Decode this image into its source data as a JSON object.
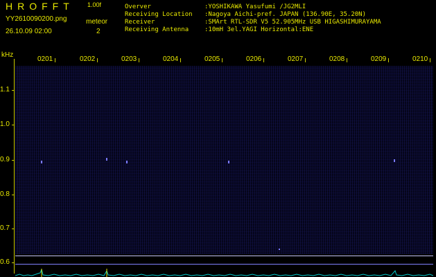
{
  "header": {
    "logo": "HROFFT",
    "version": "1.00f",
    "filename": "YY2610090200.png",
    "meteor_label": "meteor",
    "meteor_count": "2",
    "datetime": "26.10.09 02:00"
  },
  "info": [
    {
      "label": "Overver",
      "value": ":YOSHIKAWA Yasufumi /JG2MLI"
    },
    {
      "label": "Receiving Location",
      "value": ":Nagoya Aichi-pref. JAPAN (136.90E, 35.20N)"
    },
    {
      "label": "Receiver",
      "value": ":SMArt RTL-SDR V5 52.905MHz USB HIGASHIMURAYAMA"
    },
    {
      "label": "Receiving Antenna",
      "value": ":10mH 3el.YAGI Horizontal:ENE"
    }
  ],
  "axis": {
    "y_unit": "kHz",
    "y_ticks": [
      "1.1",
      "1.0",
      "0.9",
      "0.8",
      "0.7",
      "0.6"
    ],
    "x_ticks": [
      "0201",
      "0202",
      "0203",
      "0204",
      "0205",
      "0206",
      "0207",
      "0208",
      "0209",
      "0210"
    ]
  },
  "colors": {
    "text": "#e8e800",
    "background": "#000000",
    "spectrogram": "#05051a",
    "waveform": "#00c8c8",
    "marker_line_1": "#c8c8ff",
    "marker_line_2": "#8080ff"
  }
}
